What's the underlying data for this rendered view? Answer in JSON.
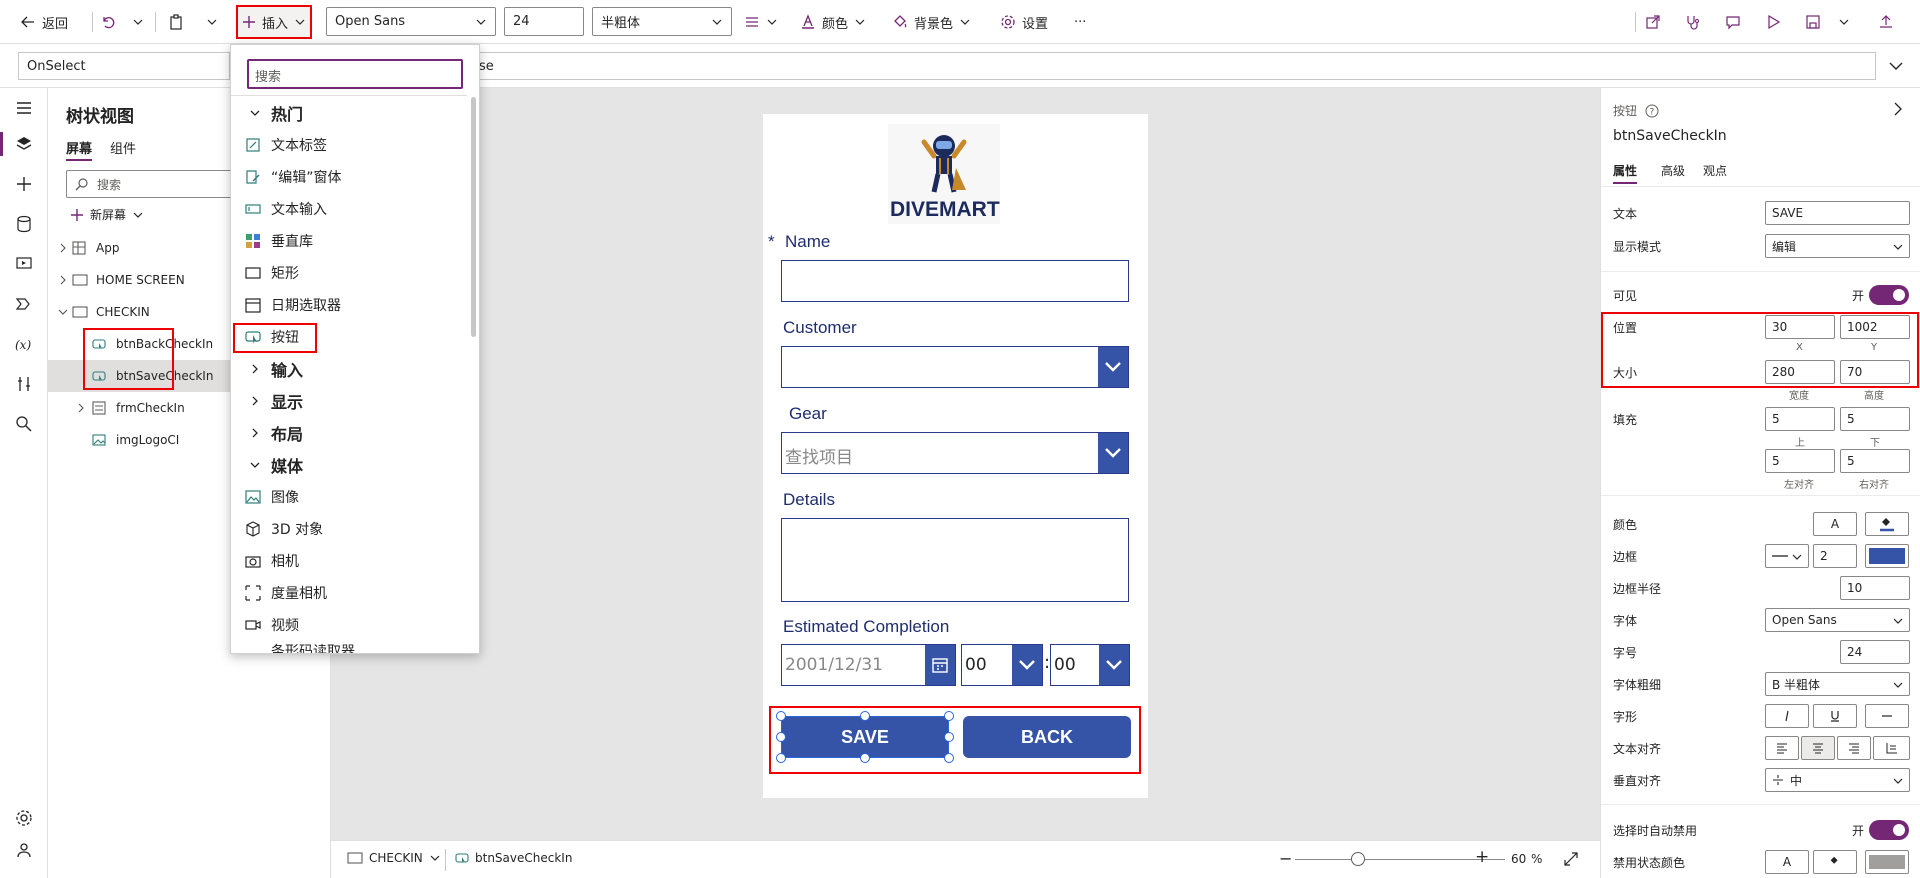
{
  "toolbar": {
    "back_label": "返回",
    "insert_label": "插入",
    "font_value": "Open Sans",
    "font_size_value": "24",
    "font_weight_value": "半粗体",
    "color_label": "颜色",
    "fill_label": "背景色",
    "settings_label": "设置",
    "more_label": "···"
  },
  "formula_bar": {
    "property": "OnSelect",
    "formula_fragment": "se"
  },
  "tree": {
    "title": "树状视图",
    "tab_screens": "屏幕",
    "tab_components": "组件",
    "search_placeholder": "搜索",
    "new_screen_label": "新屏幕",
    "items": [
      {
        "label": "App"
      },
      {
        "label": "HOME SCREEN"
      },
      {
        "label": "CHECKIN"
      },
      {
        "label": "btnBackCheckIn"
      },
      {
        "label": "btnSaveCheckIn"
      },
      {
        "label": "frmCheckIn"
      },
      {
        "label": "imgLogoCI"
      }
    ]
  },
  "insert_menu": {
    "search_placeholder": "搜索",
    "groups": [
      {
        "label": "热门",
        "expanded": true,
        "items": [
          "文本标签",
          "“编辑”窗体",
          "文本输入",
          "垂直库",
          "矩形",
          "日期选取器",
          "按钮"
        ]
      },
      {
        "label": "输入",
        "expanded": false
      },
      {
        "label": "显示",
        "expanded": false
      },
      {
        "label": "布局",
        "expanded": false
      },
      {
        "label": "媒体",
        "expanded": true,
        "items": [
          "图像",
          "3D 对象",
          "相机",
          "度量相机",
          "视频",
          "条形码读取器"
        ]
      }
    ]
  },
  "app_screen": {
    "logo_text": "DIVEMART",
    "required_mark": "*",
    "fields": {
      "name_label": "Name",
      "customer_label": "Customer",
      "gear_label": "Gear",
      "gear_placeholder": "查找项目",
      "details_label": "Details",
      "completion_label": "Estimated Completion",
      "date_placeholder": "2001/12/31",
      "hour_value": "00",
      "minute_value": "00",
      "time_separator": ":"
    },
    "save_label": "SAVE",
    "back_label": "BACK"
  },
  "status_bar": {
    "screen_name": "CHECKIN",
    "selected_control": "btnSaveCheckIn",
    "zoom_value": "60",
    "zoom_unit": "%",
    "zoom_minus": "−",
    "zoom_plus": "+"
  },
  "properties": {
    "type_label": "按钮",
    "control_name": "btnSaveCheckIn",
    "tabs": [
      "属性",
      "高级",
      "观点"
    ],
    "text_label": "文本",
    "text_value": "SAVE",
    "display_mode_label": "显示模式",
    "display_mode_value": "编辑",
    "visible_label": "可见",
    "visible_value": "开",
    "position_label": "位置",
    "x_value": "30",
    "y_value": "1002",
    "x_caption": "X",
    "y_caption": "Y",
    "size_label": "大小",
    "width_value": "280",
    "height_value": "70",
    "width_caption": "宽度",
    "height_caption": "高度",
    "padding_label": "填充",
    "pad_top": "5",
    "pad_bottom": "5",
    "pad_left": "5",
    "pad_right": "5",
    "pad_top_caption": "上",
    "pad_bottom_caption": "下",
    "pad_left_caption": "左对齐",
    "pad_right_caption": "右对齐",
    "color_label": "颜色",
    "color_text_glyph": "A",
    "border_label": "边框",
    "border_width": "2",
    "border_color": "#3554a8",
    "radius_label": "边框半径",
    "radius_value": "10",
    "font_label": "字体",
    "font_value": "Open Sans",
    "font_size_label": "字号",
    "font_size_value": "24",
    "font_weight_label": "字体粗细",
    "font_weight_value": "B 半粗体",
    "font_style_label": "字形",
    "text_align_label": "文本对齐",
    "vertical_align_label": "垂直对齐",
    "vertical_align_value": "中",
    "auto_disable_label": "选择时自动禁用",
    "auto_disable_value": "开",
    "disabled_color_label": "禁用状态颜色"
  },
  "colors": {
    "accent_purple": "#742774",
    "button_blue": "#3554a8",
    "highlight_red": "#ee0000"
  }
}
